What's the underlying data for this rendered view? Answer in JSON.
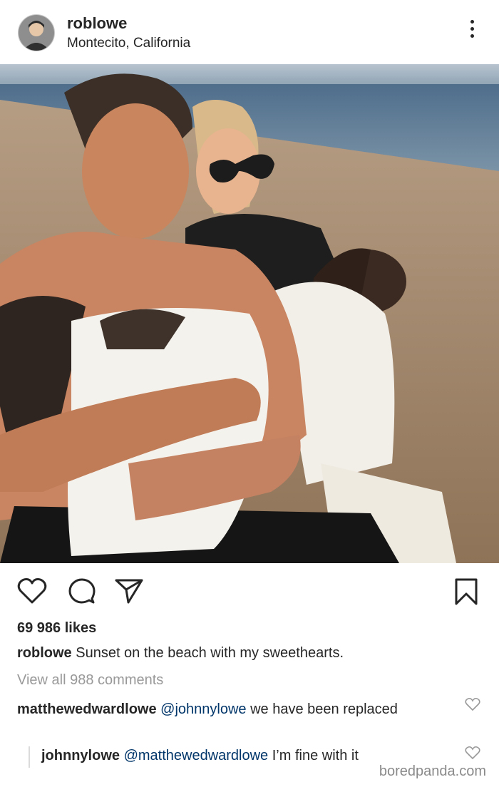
{
  "post": {
    "username": "roblowe",
    "location": "Montecito, California"
  },
  "actions": {
    "like_icon": "heart-icon",
    "comment_icon": "comment-icon",
    "share_icon": "paper-plane-icon",
    "save_icon": "bookmark-icon"
  },
  "likes": "69 986 likes",
  "caption": {
    "username": "roblowe",
    "text": "Sunset on the beach with my sweethearts."
  },
  "view_all_comments": "View all 988 comments",
  "comments": [
    {
      "username": "matthewedwardlowe",
      "mention": "@johnnylowe",
      "text": "we have been replaced"
    },
    {
      "username": "johnnylowe",
      "mention": "@matthewedwardlowe",
      "text": "I’m fine with it"
    }
  ],
  "watermark": "boredpanda.com",
  "colors": {
    "text": "#262626",
    "muted": "#999999",
    "mention": "#003569"
  }
}
